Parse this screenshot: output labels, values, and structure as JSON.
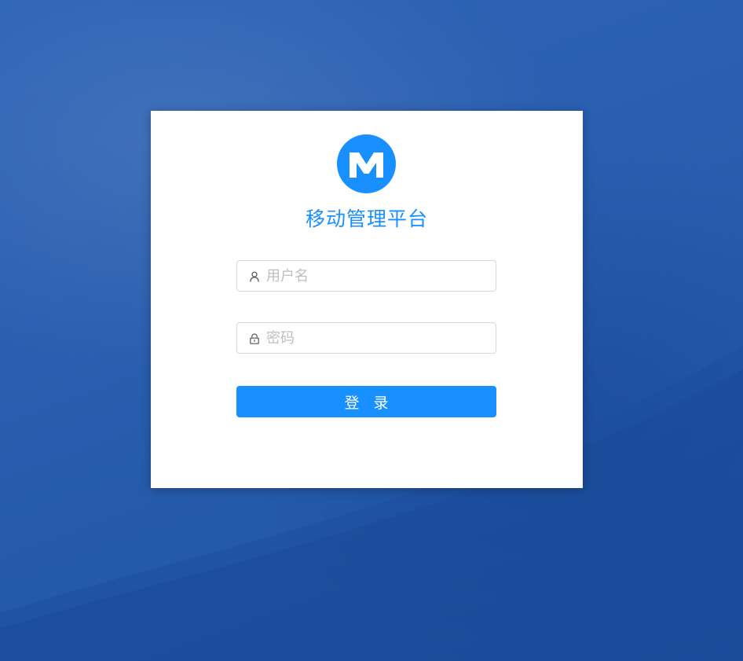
{
  "app": {
    "title": "移动管理平台",
    "logo_letter": "M"
  },
  "login": {
    "username": {
      "icon": "user-icon",
      "placeholder": "用户名",
      "value": ""
    },
    "password": {
      "icon": "lock-icon",
      "placeholder": "密码",
      "value": ""
    },
    "submit_label": "登 录"
  },
  "colors": {
    "background": "#2a5eb0",
    "accent": "#1890ff",
    "card": "#ffffff",
    "input_border": "#d9d9d9",
    "placeholder": "#bfbfbf"
  }
}
